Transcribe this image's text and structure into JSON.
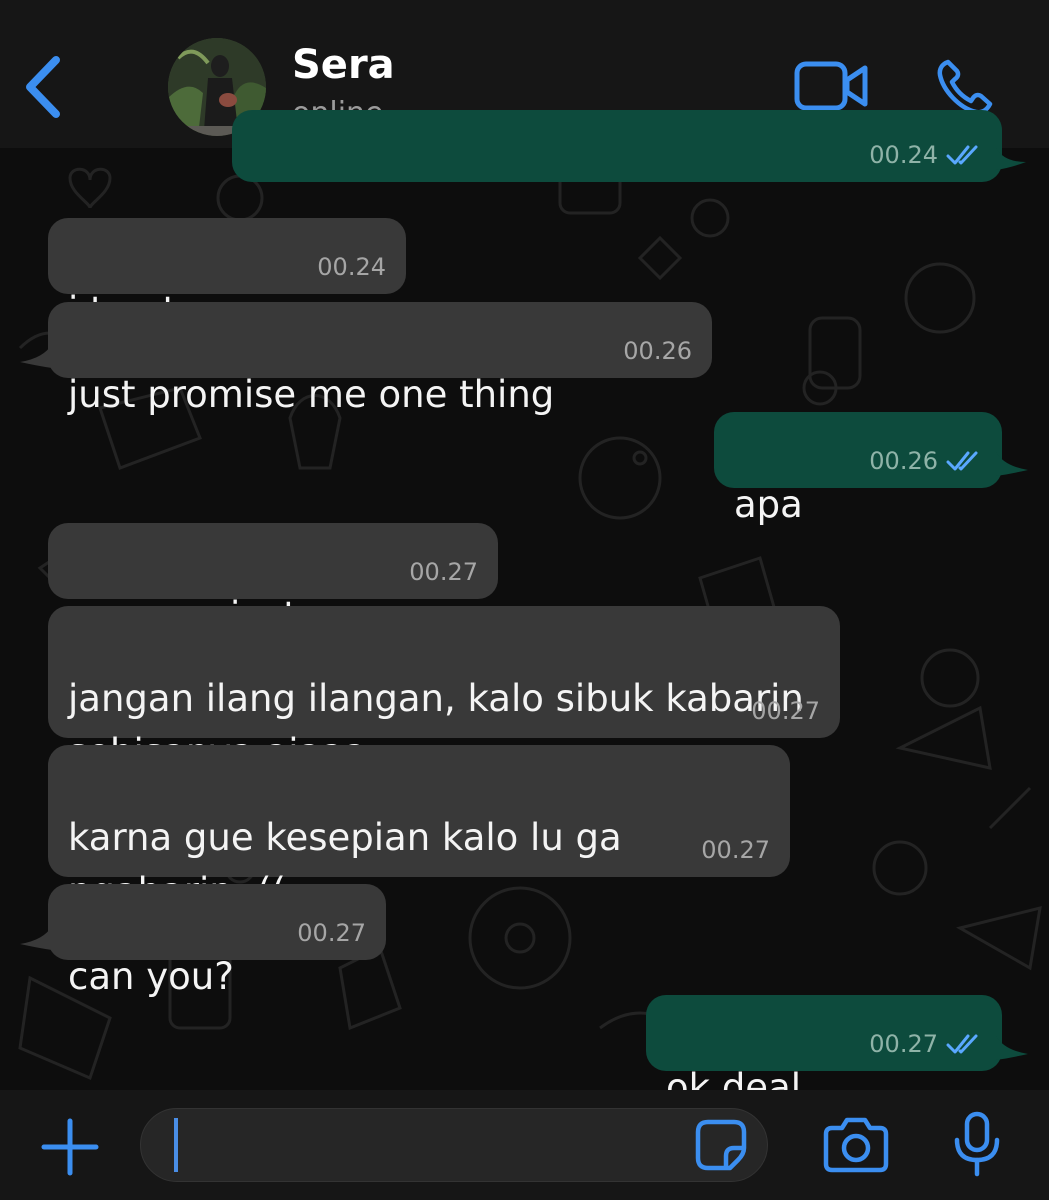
{
  "header": {
    "name": "Sera",
    "status": "online"
  },
  "messages": [
    {
      "dir": "out",
      "text": "",
      "time": "00.24",
      "read": true
    },
    {
      "dir": "in",
      "text": "i trust you",
      "time": "00.24"
    },
    {
      "dir": "in",
      "text": "just promise me one thing",
      "time": "00.26"
    },
    {
      "dir": "out",
      "text": "apa",
      "time": "00.26",
      "read": true
    },
    {
      "dir": "in",
      "text": "communicate..",
      "time": "00.27"
    },
    {
      "dir": "in",
      "text": "jangan ilang ilangan, kalo sibuk kabarin\nsebisanya ajaaa",
      "time": "00.27"
    },
    {
      "dir": "in",
      "text": "karna gue kesepian kalo lu ga\nngabarin :((",
      "time": "00.27"
    },
    {
      "dir": "in",
      "text": "can you?",
      "time": "00.27"
    },
    {
      "dir": "out",
      "text": "ok deal",
      "time": "00.27",
      "read": true
    }
  ],
  "input": {
    "value": ""
  },
  "icons": {
    "back": "chevron-left-icon",
    "video": "video-camera-icon",
    "phone": "phone-icon",
    "plus": "plus-icon",
    "sticker": "sticker-icon",
    "camera": "camera-icon",
    "mic": "microphone-icon"
  },
  "colors": {
    "accent": "#3b8ef0",
    "incoming_bubble": "#393939",
    "outgoing_bubble": "#0d4b3d",
    "read_ticks": "#5aa8ff"
  }
}
